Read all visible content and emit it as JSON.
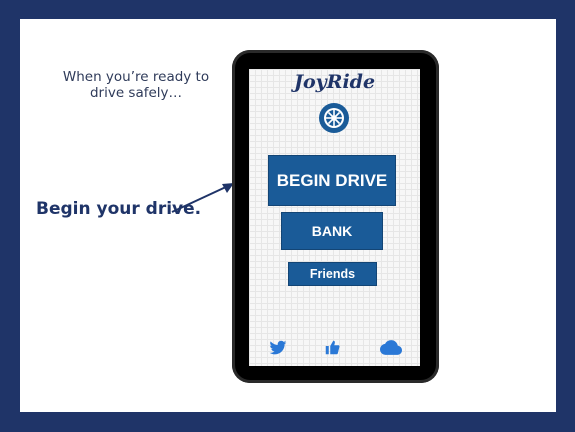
{
  "slide": {
    "caption": "When you’re ready to drive safely…",
    "begin_label": "Begin your drive."
  },
  "app": {
    "logo_text": "JoyRide",
    "buttons": {
      "begin": "BEGIN DRIVE",
      "bank": "BANK",
      "friends": "Friends"
    },
    "bottom_icons": [
      "twitter-icon",
      "thumbs-up-icon",
      "cloud-icon"
    ]
  },
  "colors": {
    "background": "#1f3468",
    "button": "#1a5b98",
    "icon": "#2a78d6"
  }
}
